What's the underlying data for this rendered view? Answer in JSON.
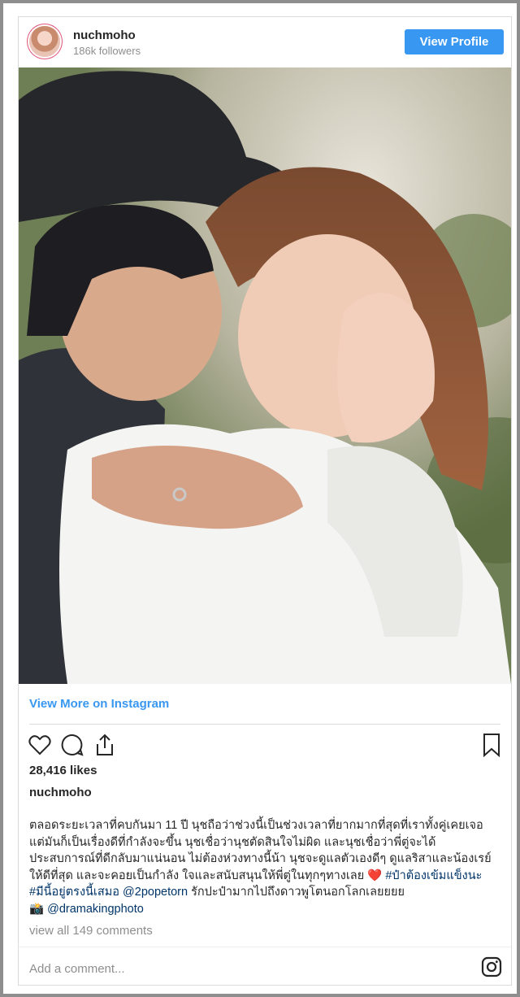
{
  "header": {
    "username": "nuchmoho",
    "followers": "186k followers",
    "view_profile": "View Profile"
  },
  "post": {
    "view_more": "View More on Instagram",
    "likes": "28,416 likes",
    "caption_user": "nuchmoho",
    "caption_lines": [
      "ตลอดระยะเวลาที่คบกันมา 11 ปี นุชถือว่าช่วงนี้เป็นช่วงเวลาที่ยากมากที่สุดที่เราทั้งคู่เคยเจอ",
      "แต่มันก็เป็นเรื่องดีที่กำลังจะขึ้น นุชเชื่อว่านุชตัดสินใจไม่ผิด และนุชเชื่อว่าพี่ตู่จะได้",
      "ประสบการณ์ที่ดีกลับมาแน่นอน ไม่ต้องห่วงทางนี้น้า นุชจะดูแลตัวเองดีๆ ดูแลริสาและน้องเรย์",
      "ให้ดีที่สุด และจะคอยเป็นกำลัง ใจและสนับสนุนให้พี่ตู่ในทุกๆทางเลย"
    ],
    "heart_emoji": "❤️",
    "hashtag1": "#ป๋าต้องเข้มแข็งนะ",
    "hashtag2": "#มีนี้อยู่ตรงนี้เสมอ",
    "mention1": "@2popetorn",
    "line5_tail": "รักปะป๋ามากไปถึงดาวพูโตนอกโลกเลยยยย",
    "camera_emoji": "📸",
    "mention2": "@dramakingphoto",
    "comments": "view all 149 comments",
    "add_comment_placeholder": "Add a comment..."
  },
  "icons": [
    "heart-icon",
    "comment-icon",
    "share-icon",
    "bookmark-icon",
    "instagram-icon"
  ],
  "colors": {
    "accent": "#3897f0",
    "link": "#003569",
    "muted": "#8e8e8e"
  }
}
